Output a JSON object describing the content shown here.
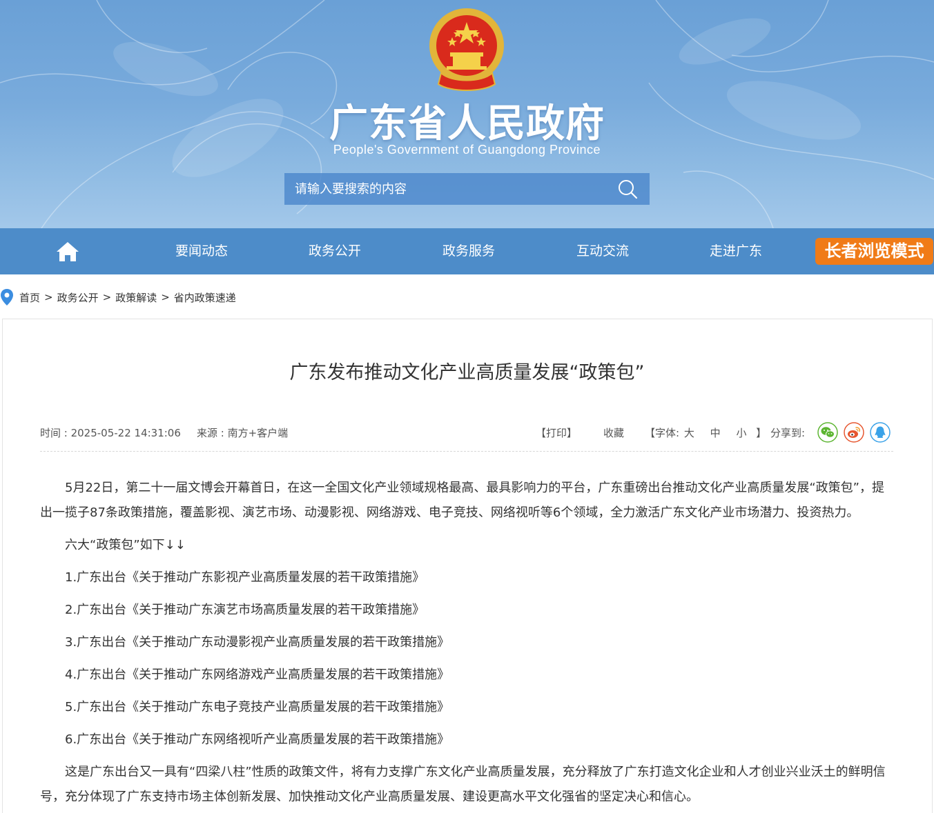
{
  "header": {
    "site_title": "广东省人民政府",
    "site_subtitle": "People's Government of Guangdong Province",
    "search_placeholder": "请输入要搜索的内容"
  },
  "nav": {
    "items": [
      "要闻动态",
      "政务公开",
      "政务服务",
      "互动交流",
      "走进广东"
    ],
    "elder_mode": "长者浏览模式"
  },
  "breadcrumb": [
    "首页",
    "政务公开",
    "政策解读",
    "省内政策速递"
  ],
  "article": {
    "title": "广东发布推动文化产业高质量发展“政策包”",
    "time": "时间 : 2025-05-22 14:31:06",
    "source": "来源 : 南方+客户端",
    "print": "【打印】",
    "favorite": "收藏",
    "font_open": "【字体:",
    "font_large": "大",
    "font_medium": "中",
    "font_small": "小",
    "font_close": "】",
    "share": "分享到:",
    "paragraphs": [
      "5月22日，第二十一届文博会开幕首日，在这一全国文化产业领域规格最高、最具影响力的平台，广东重磅出台推动文化产业高质量发展“政策包”，提出一揽子87条政策措施，覆盖影视、演艺市场、动漫影视、网络游戏、电子竞技、网络视听等6个领域，全力激活广东文化产业市场潜力、投资热力。",
      "六大“政策包”如下↓↓",
      "1.广东出台《关于推动广东影视产业高质量发展的若干政策措施》",
      "2.广东出台《关于推动广东演艺市场高质量发展的若干政策措施》",
      "3.广东出台《关于推动广东动漫影视产业高质量发展的若干政策措施》",
      "4.广东出台《关于推动广东网络游戏产业高质量发展的若干政策措施》",
      "5.广东出台《关于推动广东电子竞技产业高质量发展的若干政策措施》",
      "6.广东出台《关于推动广东网络视听产业高质量发展的若干政策措施》",
      "这是广东出台又一具有“四梁八柱”性质的政策文件，将有力支撑广东文化产业高质量发展，充分释放了广东打造文化企业和人才创业兴业沃土的鲜明信号，充分体现了广东支持市场主体创新发展、加快推动文化产业高质量发展、建设更高水平文化强省的坚定决心和信心。"
    ]
  },
  "colors": {
    "nav_bg": "#4d8cc9",
    "elder_btn": "#f07b17",
    "wechat": "#5cb531",
    "weibo": "#e6562f",
    "qq": "#3aa2e8"
  }
}
